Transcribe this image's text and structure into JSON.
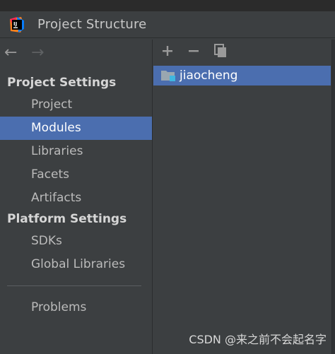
{
  "window": {
    "title": "Project Structure"
  },
  "nav": {
    "back": "←",
    "forward": "→"
  },
  "left": {
    "project_settings_header": "Project Settings",
    "project_items": [
      "Project",
      "Modules",
      "Libraries",
      "Facets",
      "Artifacts"
    ],
    "platform_settings_header": "Platform Settings",
    "platform_items": [
      "SDKs",
      "Global Libraries"
    ],
    "problems": "Problems",
    "selected": "Modules"
  },
  "right": {
    "toolbar": {
      "add": "+",
      "remove": "−",
      "copy": "copy"
    },
    "modules": [
      "jiaocheng"
    ]
  },
  "watermark": "CSDN @来之前不会起名字",
  "colors": {
    "background": "#3c3f41",
    "selection": "#4b6eaf",
    "text": "#bbbbbb",
    "header_text": "#d6d6d6"
  }
}
